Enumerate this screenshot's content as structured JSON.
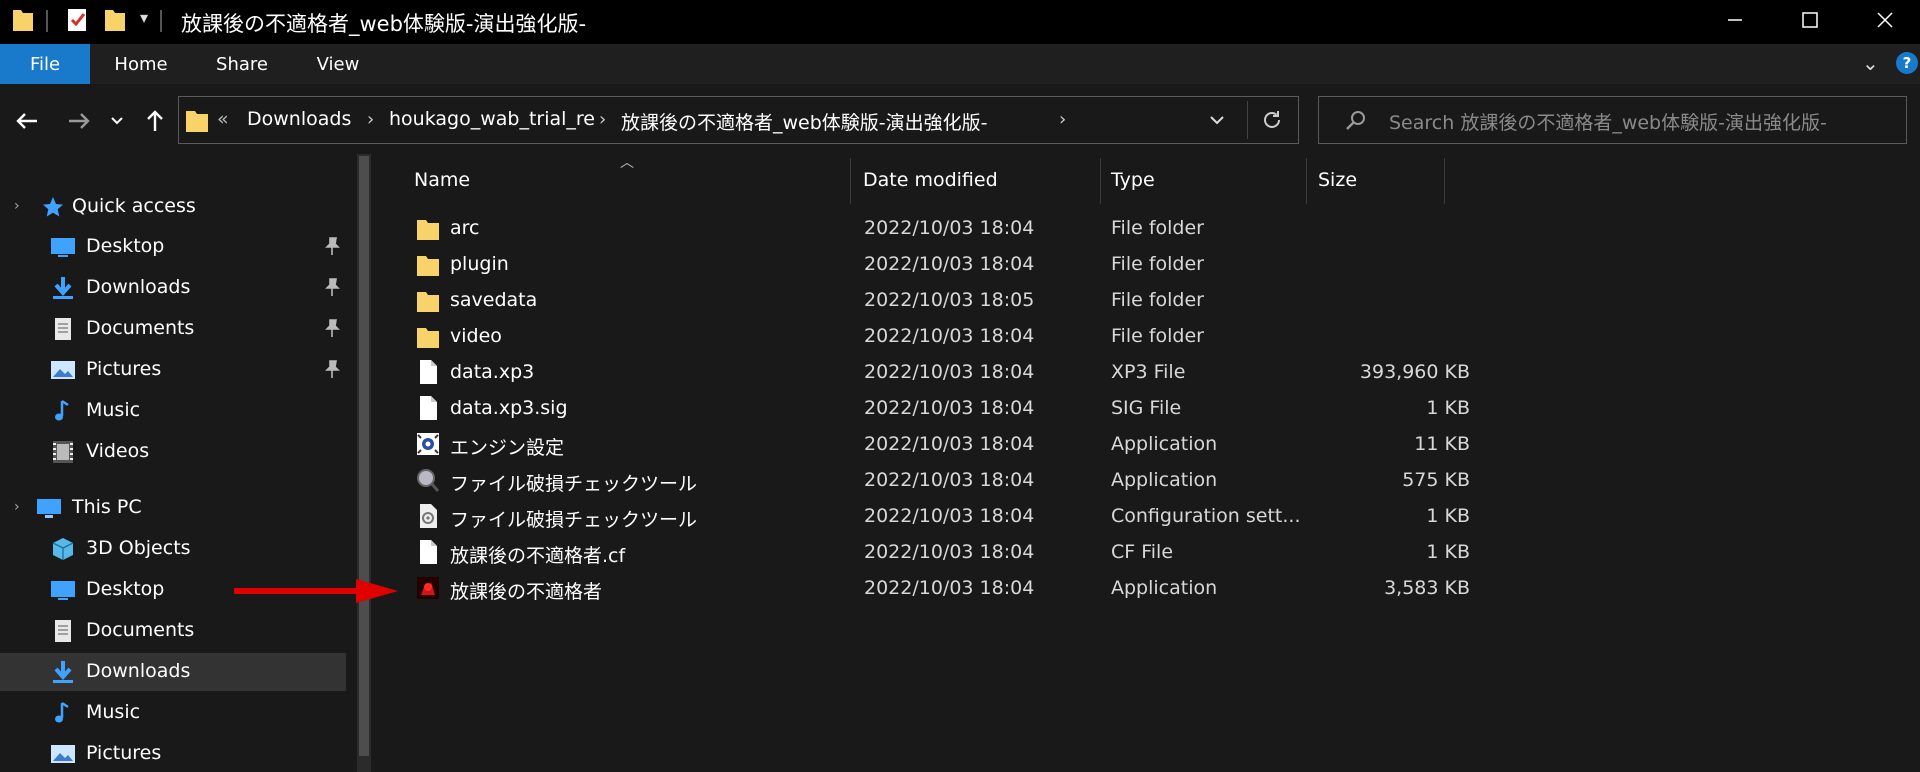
{
  "window": {
    "title": "放課後の不適格者_web体験版-演出強化版-",
    "minimize_icon": "minimize-icon",
    "maximize_icon": "maximize-icon",
    "close_icon": "close-icon"
  },
  "ribbon": {
    "tabs": [
      {
        "label": "File",
        "active": true
      },
      {
        "label": "Home"
      },
      {
        "label": "Share"
      },
      {
        "label": "View"
      }
    ],
    "accent": "#1979ca"
  },
  "address": {
    "overflow": "«",
    "crumbs": [
      "Downloads",
      "houkago_wab_trial_re",
      "放課後の不適格者_web体験版-演出強化版-"
    ]
  },
  "search": {
    "placeholder": "Search 放課後の不適格者_web体験版-演出強化版-"
  },
  "nav": {
    "quick_access": "Quick access",
    "quick_items": [
      {
        "label": "Desktop",
        "icon": "desktop-icon",
        "pinned": true
      },
      {
        "label": "Downloads",
        "icon": "downloads-icon",
        "pinned": true
      },
      {
        "label": "Documents",
        "icon": "documents-icon",
        "pinned": true
      },
      {
        "label": "Pictures",
        "icon": "pictures-icon",
        "pinned": true
      },
      {
        "label": "Music",
        "icon": "music-icon"
      },
      {
        "label": "Videos",
        "icon": "videos-icon"
      }
    ],
    "this_pc": "This PC",
    "pc_items": [
      {
        "label": "3D Objects",
        "icon": "3d-objects-icon"
      },
      {
        "label": "Desktop",
        "icon": "desktop-icon"
      },
      {
        "label": "Documents",
        "icon": "documents-icon"
      },
      {
        "label": "Downloads",
        "icon": "downloads-icon",
        "selected": true
      },
      {
        "label": "Music",
        "icon": "music-icon"
      },
      {
        "label": "Pictures",
        "icon": "pictures-icon"
      }
    ]
  },
  "columns": {
    "name": "Name",
    "date": "Date modified",
    "type": "Type",
    "size": "Size"
  },
  "files": [
    {
      "name": "arc",
      "date": "2022/10/03 18:04",
      "type": "File folder",
      "size": "",
      "icon": "folder-icon"
    },
    {
      "name": "plugin",
      "date": "2022/10/03 18:04",
      "type": "File folder",
      "size": "",
      "icon": "folder-icon"
    },
    {
      "name": "savedata",
      "date": "2022/10/03 18:05",
      "type": "File folder",
      "size": "",
      "icon": "folder-icon"
    },
    {
      "name": "video",
      "date": "2022/10/03 18:04",
      "type": "File folder",
      "size": "",
      "icon": "folder-icon"
    },
    {
      "name": "data.xp3",
      "date": "2022/10/03 18:04",
      "type": "XP3 File",
      "size": "393,960 KB",
      "icon": "file-icon"
    },
    {
      "name": "data.xp3.sig",
      "date": "2022/10/03 18:04",
      "type": "SIG File",
      "size": "1 KB",
      "icon": "file-icon"
    },
    {
      "name": "エンジン設定",
      "date": "2022/10/03 18:04",
      "type": "Application",
      "size": "11 KB",
      "icon": "engine-settings-icon"
    },
    {
      "name": "ファイル破損チェックツール",
      "date": "2022/10/03 18:04",
      "type": "Application",
      "size": "575 KB",
      "icon": "magnifier-app-icon"
    },
    {
      "name": "ファイル破損チェックツール",
      "date": "2022/10/03 18:04",
      "type": "Configuration sett...",
      "size": "1 KB",
      "icon": "config-file-icon"
    },
    {
      "name": "放課後の不適格者.cf",
      "date": "2022/10/03 18:04",
      "type": "CF File",
      "size": "1 KB",
      "icon": "file-icon"
    },
    {
      "name": "放課後の不適格者",
      "date": "2022/10/03 18:04",
      "type": "Application",
      "size": "3,583 KB",
      "icon": "game-app-icon"
    }
  ],
  "annotation": {
    "icon": "red-arrow-icon",
    "color": "#e00000"
  }
}
